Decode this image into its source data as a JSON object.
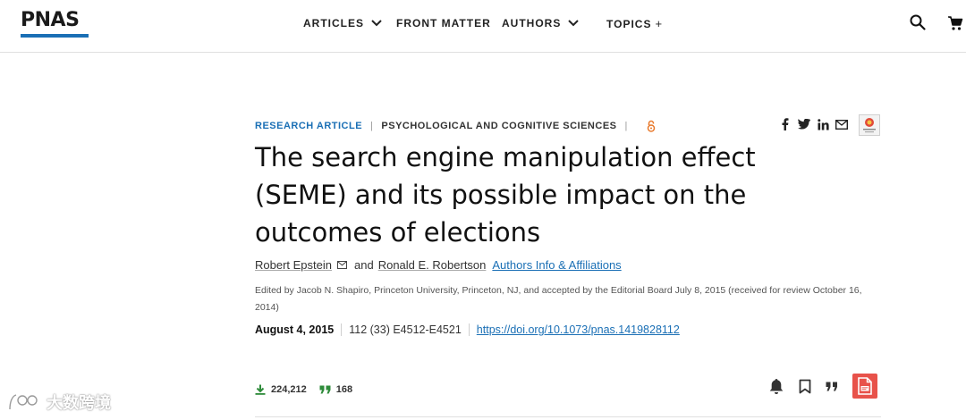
{
  "header": {
    "logo": "PNAS",
    "nav": [
      {
        "label": "ARTICLES",
        "indicator": "chevron-down"
      },
      {
        "label": "FRONT MATTER",
        "indicator": ""
      },
      {
        "label": "AUTHORS",
        "indicator": "chevron-down"
      },
      {
        "label": "TOPICS",
        "indicator": "plus"
      }
    ],
    "topics_plus": "+",
    "icons": [
      "search-icon",
      "cart-icon"
    ]
  },
  "article": {
    "type": "RESEARCH ARTICLE",
    "separator": "|",
    "category": "PSYCHOLOGICAL AND COGNITIVE SCIENCES",
    "open_access_icon": "open-access-icon",
    "share_icons": [
      "facebook-icon",
      "twitter-icon",
      "linkedin-icon",
      "email-icon"
    ],
    "title": "The search engine manipulation effect (SEME) and its possible impact on the outcomes of elections",
    "authors": {
      "author1": "Robert Epstein",
      "conjunction": "and",
      "author2": "Ronald E. Robertson",
      "affiliations_link": "Authors Info & Affiliations"
    },
    "edited_by": "Edited by Jacob N. Shapiro, Princeton University, Princeton, NJ, and accepted by the Editorial Board July 8, 2015 (received for review October 16, 2014)",
    "pub_date": "August 4, 2015",
    "citation": "112 (33) E4512-E4521",
    "doi": "https://doi.org/10.1073/pnas.1419828112",
    "stats": {
      "downloads": "224,212",
      "citations": "168"
    },
    "actions": [
      "bell-icon",
      "bookmark-icon",
      "cite-icon",
      "pdf-icon"
    ]
  },
  "watermark": "大数跨境",
  "colors": {
    "brand_blue": "#1a6fb5",
    "oa_orange": "#e8782a",
    "stat_green": "#2e8b3a",
    "pdf_red": "#e8524a"
  }
}
